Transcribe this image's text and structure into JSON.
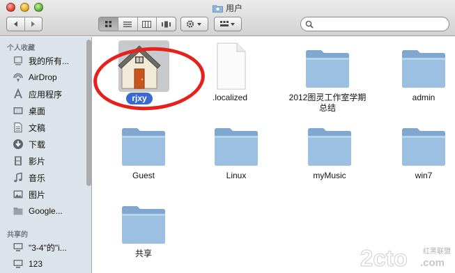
{
  "window": {
    "title": "用户"
  },
  "toolbar": {
    "back_icon": "chevron-left-icon",
    "forward_icon": "chevron-right-icon",
    "views": [
      "icon-view-icon",
      "list-view-icon",
      "column-view-icon",
      "coverflow-view-icon"
    ],
    "action_icon": "gear-icon",
    "arrange_icon": "arrange-icon",
    "search": {
      "placeholder": "",
      "value": ""
    }
  },
  "sidebar": {
    "favorites_header": "个人收藏",
    "favorites": [
      {
        "label": "我的所有...",
        "icon": "all-files-icon"
      },
      {
        "label": "AirDrop",
        "icon": "airdrop-icon"
      },
      {
        "label": "应用程序",
        "icon": "applications-icon"
      },
      {
        "label": "桌面",
        "icon": "desktop-icon"
      },
      {
        "label": "文稿",
        "icon": "documents-icon"
      },
      {
        "label": "下载",
        "icon": "downloads-icon"
      },
      {
        "label": "影片",
        "icon": "movies-icon"
      },
      {
        "label": "音乐",
        "icon": "music-icon"
      },
      {
        "label": "图片",
        "icon": "pictures-icon"
      },
      {
        "label": "Google...",
        "icon": "folder-icon"
      }
    ],
    "shared_header": "共享的",
    "shared": [
      {
        "label": "\"3-4\"的\"i...",
        "icon": "computer-icon"
      },
      {
        "label": "123",
        "icon": "computer-icon"
      }
    ]
  },
  "files": [
    {
      "name": "rjxy",
      "kind": "home",
      "selected": true
    },
    {
      "name": ".localized",
      "kind": "document",
      "dimmed": true
    },
    {
      "name": "2012图灵工作室学期总结",
      "kind": "folder"
    },
    {
      "name": "admin",
      "kind": "folder"
    },
    {
      "name": "Guest",
      "kind": "folder"
    },
    {
      "name": "Linux",
      "kind": "folder"
    },
    {
      "name": "myMusic",
      "kind": "folder"
    },
    {
      "name": "win7",
      "kind": "folder"
    },
    {
      "name": "共享",
      "kind": "folder"
    }
  ],
  "annotation": {
    "color": "#e6211c"
  },
  "watermark": {
    "brand": "2cto",
    "domain": ".com",
    "cn": "红黑联盟"
  },
  "colors": {
    "selection": "#3b69d3",
    "sidebar_bg": "#dde3ea"
  }
}
